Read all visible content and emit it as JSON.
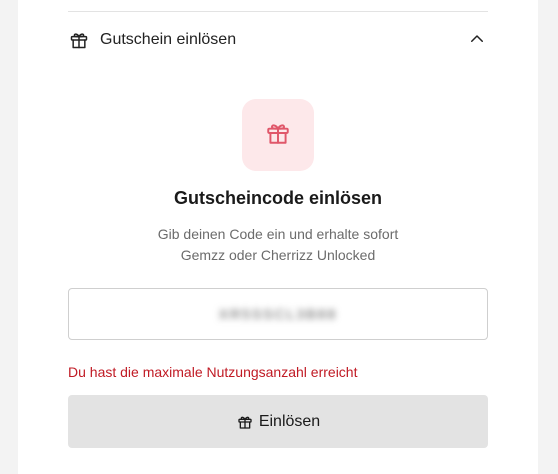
{
  "section": {
    "title": "Gutschein einlösen",
    "expanded": true
  },
  "main": {
    "title": "Gutscheincode einlösen",
    "subtitle_line1": "Gib deinen Code ein und erhalte sofort",
    "subtitle_line2": "Gemzz oder Cherrizz Unlocked"
  },
  "input": {
    "value": "XR5SSCL3B88"
  },
  "error": {
    "message": "Du hast die maximale Nutzungsanzahl erreicht"
  },
  "button": {
    "label": "Einlösen"
  },
  "colors": {
    "accent": "#e0576a",
    "accent_bg": "#fde8ea",
    "error": "#c01a24",
    "button_bg": "#e3e3e3"
  },
  "icons": {
    "header": "gift-icon",
    "chevron": "chevron-up-icon",
    "tile": "gift-icon",
    "button": "gift-icon"
  }
}
